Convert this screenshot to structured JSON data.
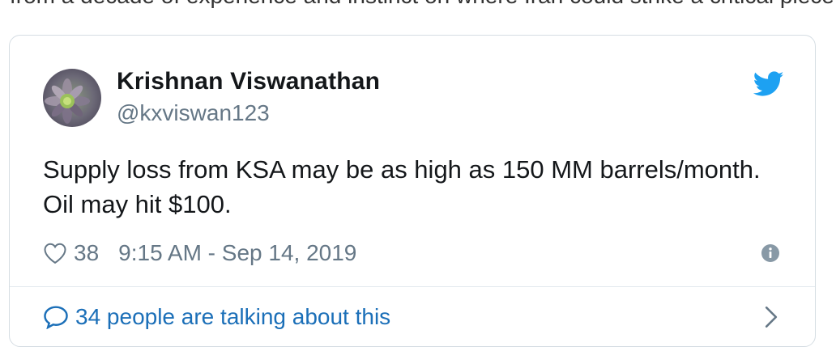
{
  "tweet": {
    "author_name": "Krishnan Viswanathan",
    "author_handle": "@kxviswan123",
    "text_line1": "Supply loss from KSA may be as high as 150 MM barrels/month.",
    "text_line2": "Oil may hit $100.",
    "likes": "38",
    "timestamp": "9:15 AM - Sep 14, 2019",
    "conversation_label": "34 people are talking about this"
  },
  "icons": {
    "brand": "twitter-bird-icon",
    "like": "heart-icon",
    "info": "info-icon",
    "reply": "speech-bubble-icon",
    "more": "chevron-right-icon"
  },
  "colors": {
    "twitter_blue": "#1da1f2",
    "link_blue": "#1b6fb8",
    "muted_text": "#657786",
    "border": "#d5dde3"
  }
}
